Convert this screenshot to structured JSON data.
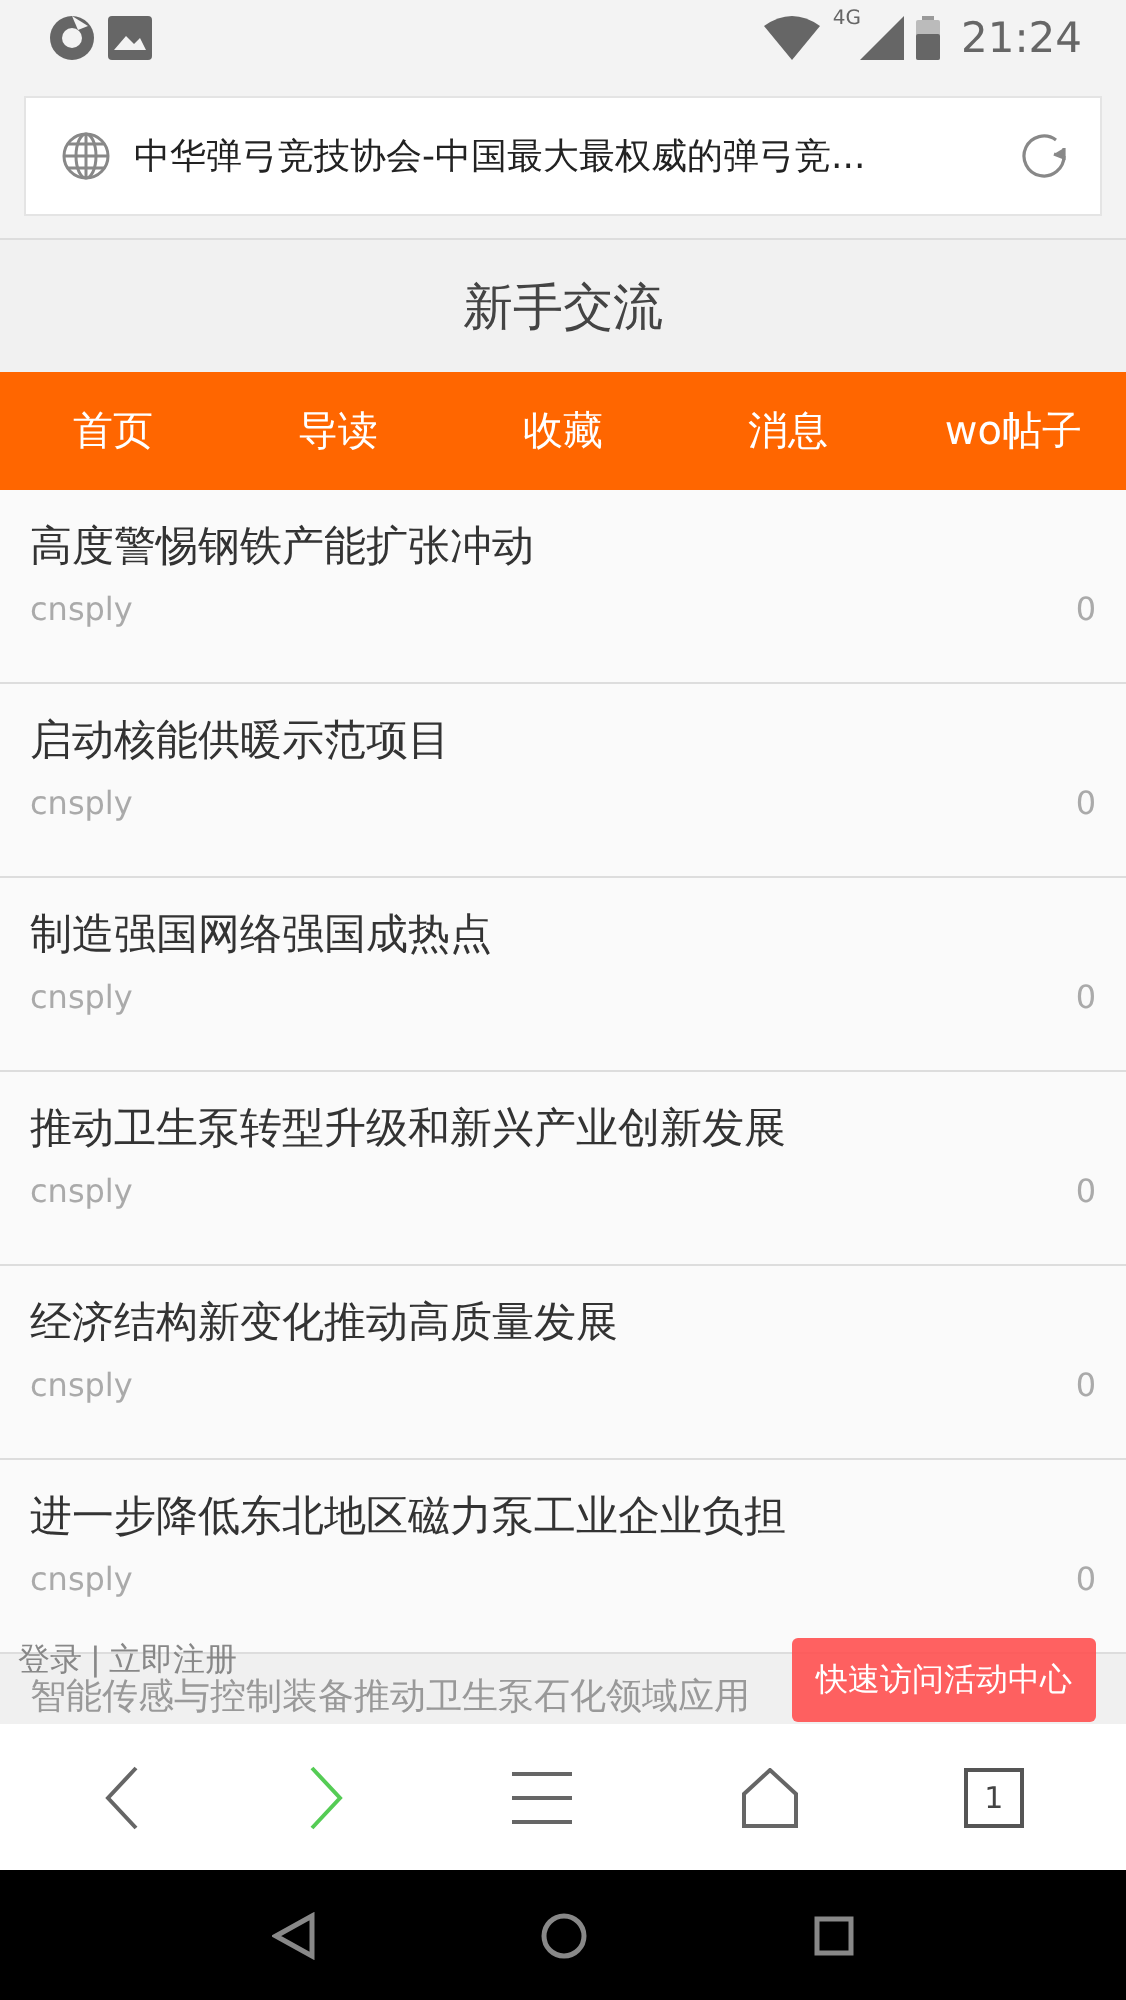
{
  "status_bar": {
    "time": "21:24",
    "network": "4G"
  },
  "address_bar": {
    "title": "中华弹弓竞技协会-中国最大最权威的弹弓竞..."
  },
  "page_title": "新手交流",
  "nav": [
    {
      "label": "首页"
    },
    {
      "label": "导读"
    },
    {
      "label": "收藏"
    },
    {
      "label": "消息"
    },
    {
      "label": "wo帖子"
    }
  ],
  "posts": [
    {
      "title": "高度警惕钢铁产能扩张冲动",
      "author": "cnsply",
      "replies": "0"
    },
    {
      "title": "启动核能供暖示范项目",
      "author": "cnsply",
      "replies": "0"
    },
    {
      "title": "制造强国网络强国成热点",
      "author": "cnsply",
      "replies": "0"
    },
    {
      "title": "推动卫生泵转型升级和新兴产业创新发展",
      "author": "cnsply",
      "replies": "0"
    },
    {
      "title": "经济结构新变化推动高质量发展",
      "author": "cnsply",
      "replies": "0"
    },
    {
      "title": "进一步降低东北地区磁力泵工业企业负担",
      "author": "cnsply",
      "replies": "0"
    },
    {
      "title": "智能传感与控制装备推动卫生泵石化领域应用"
    }
  ],
  "login_bar": {
    "login": "登录",
    "separator": "|",
    "register": "立即注册",
    "activity_button": "快速访问活动中心"
  },
  "toolbar": {
    "tab_count": "1"
  }
}
